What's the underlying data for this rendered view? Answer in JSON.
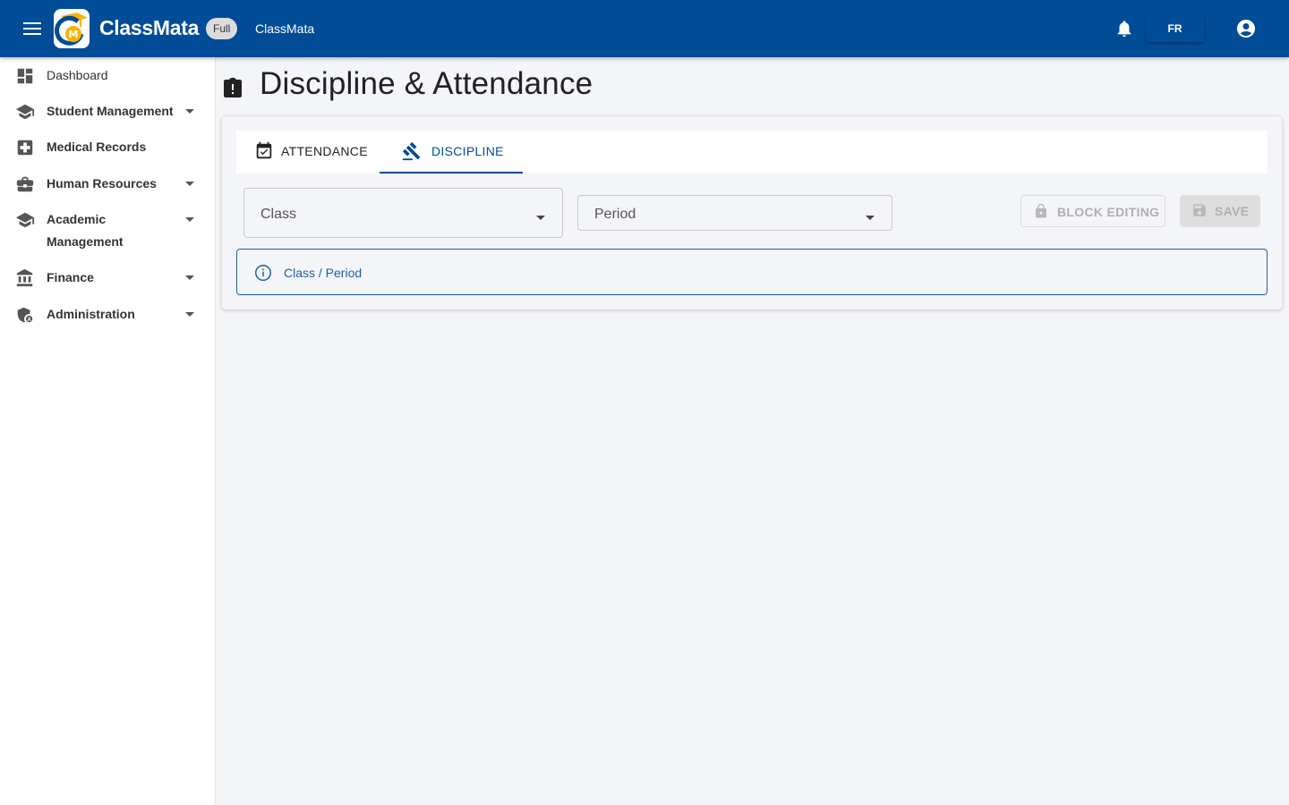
{
  "header": {
    "brand": "ClassMata",
    "badge": "Full",
    "breadcrumb": "ClassMata",
    "language": "FR",
    "colors": {
      "primary": "#004c97",
      "logo_accent": "#f7b400"
    }
  },
  "sidebar": {
    "items": [
      {
        "label": "Dashboard",
        "icon": "dashboard-icon",
        "expandable": false
      },
      {
        "label": "Student Management",
        "icon": "school-icon",
        "expandable": true
      },
      {
        "label": "Medical Records",
        "icon": "medical-icon",
        "expandable": false
      },
      {
        "label": "Human Resources",
        "icon": "briefcase-icon",
        "expandable": true
      },
      {
        "label": "Academic Management",
        "icon": "school-icon",
        "expandable": true
      },
      {
        "label": "Finance",
        "icon": "bank-icon",
        "expandable": true
      },
      {
        "label": "Administration",
        "icon": "admin-shield-icon",
        "expandable": true
      }
    ]
  },
  "page": {
    "title": "Discipline & Attendance"
  },
  "tabs": [
    {
      "label": "ATTENDANCE",
      "icon": "calendar-check-icon",
      "active": false
    },
    {
      "label": "DISCIPLINE",
      "icon": "gavel-icon",
      "active": true
    }
  ],
  "filters": {
    "class_label": "Class",
    "period_label": "Period"
  },
  "actions": {
    "block_editing": "BLOCK EDITING",
    "save": "SAVE"
  },
  "info": {
    "message": "Class / Period"
  }
}
